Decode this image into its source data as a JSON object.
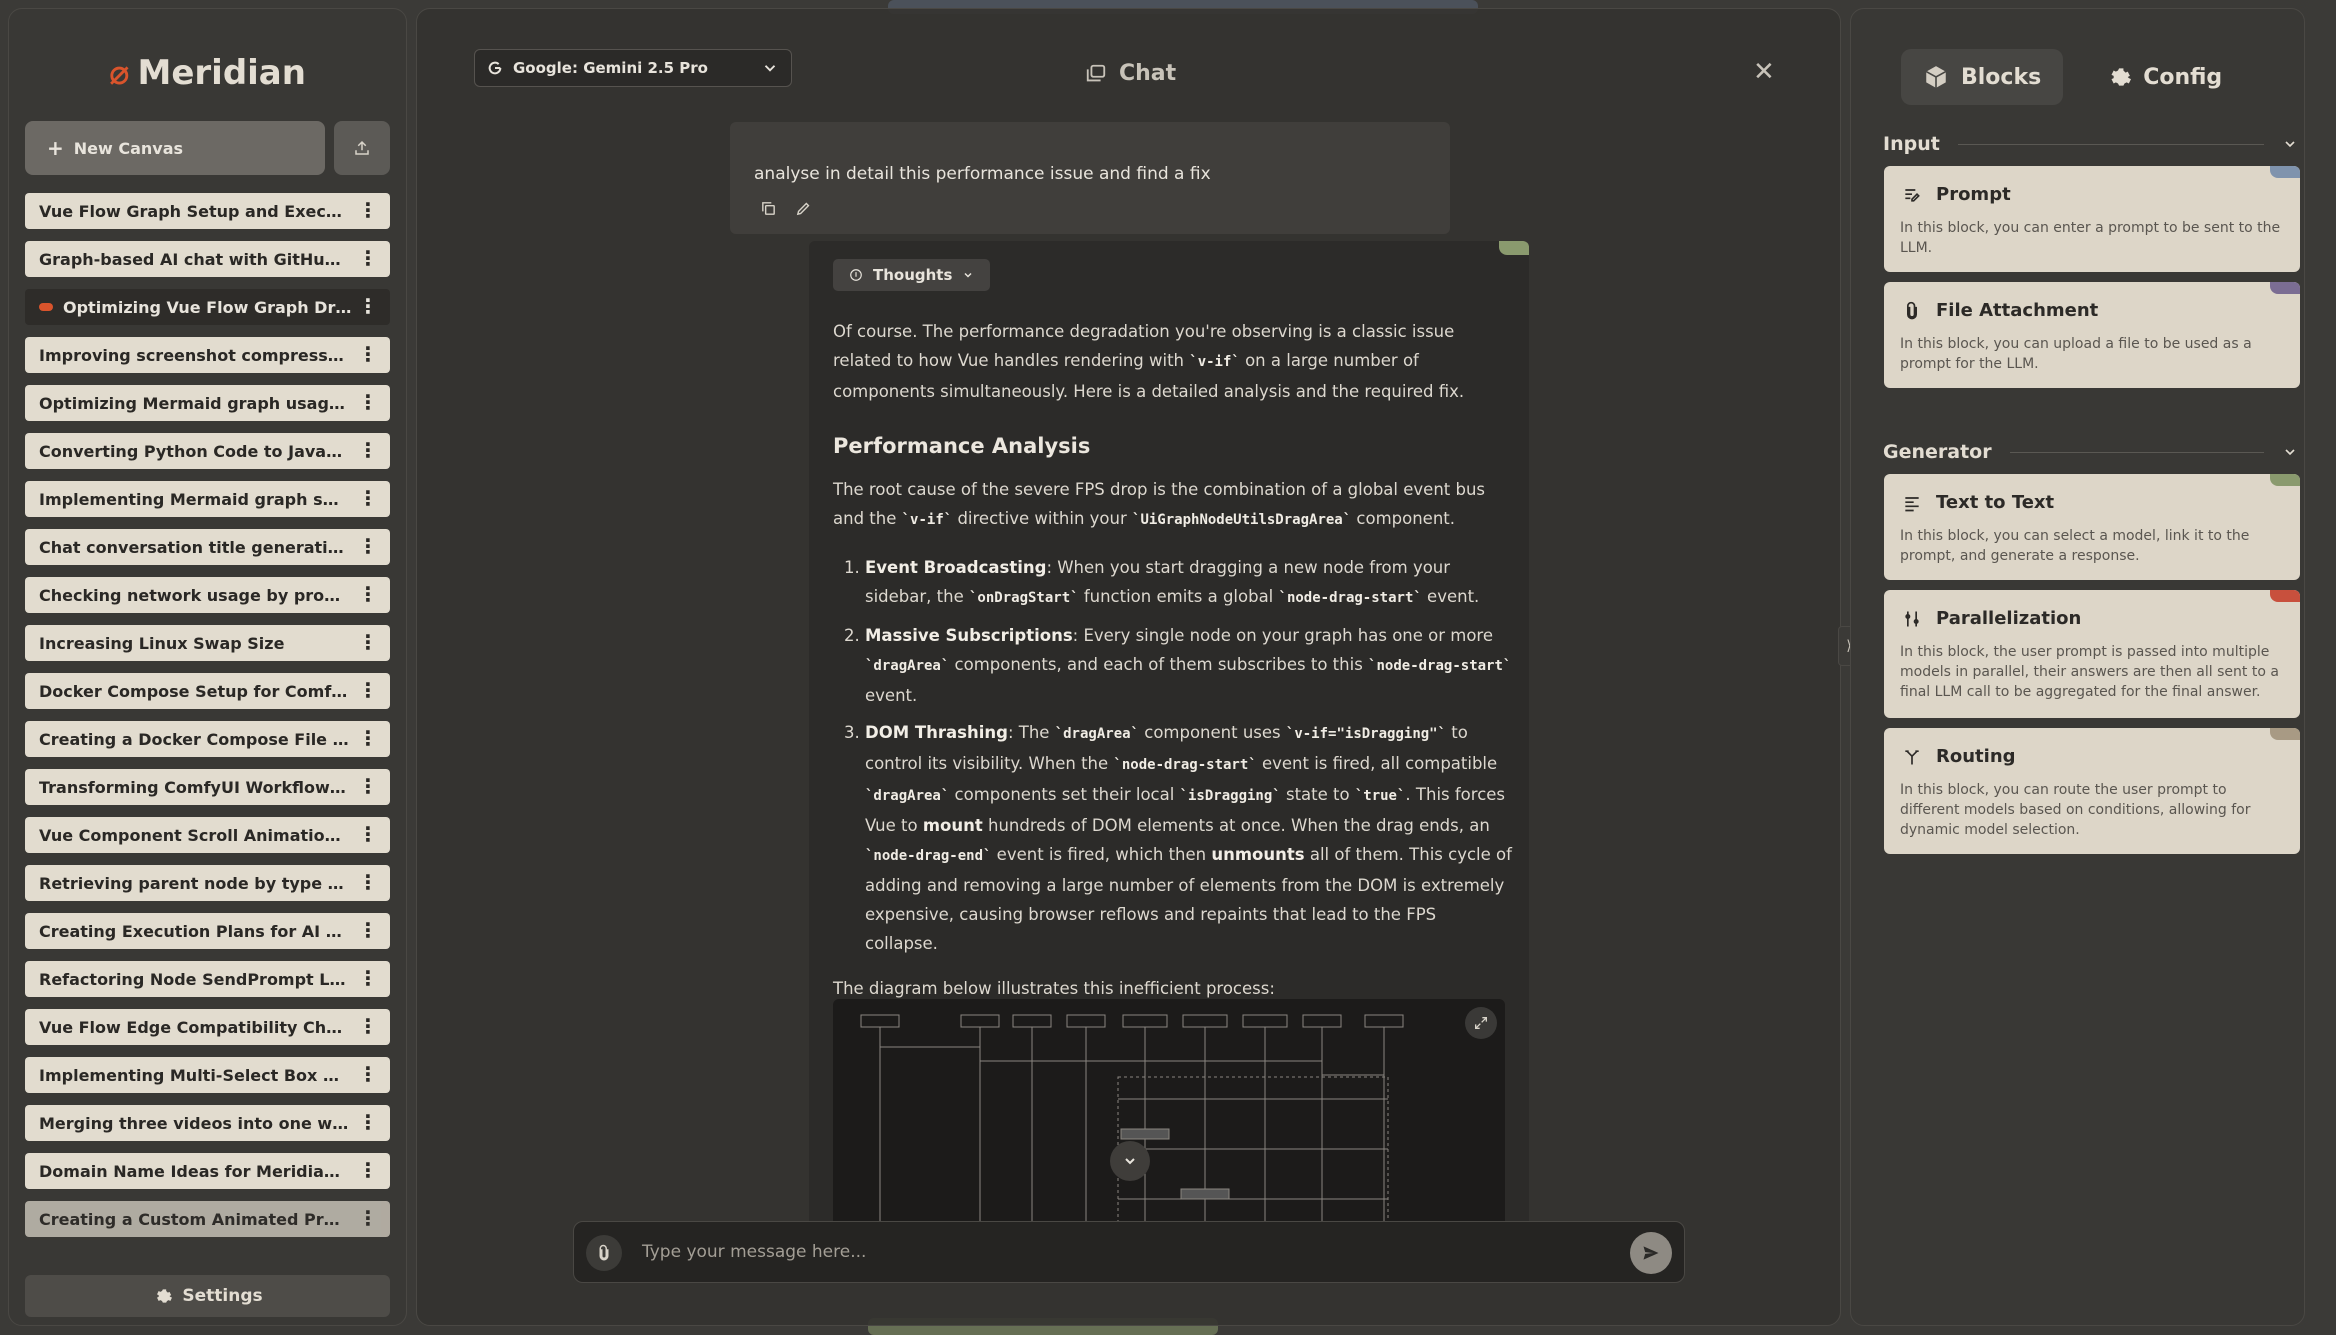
{
  "app": {
    "logo_text": "Meridian",
    "new_canvas_label": "New Canvas",
    "settings_label": "Settings",
    "accent_color": "#d9542c"
  },
  "sidebar": {
    "conversations": [
      {
        "title": "Vue Flow Graph Setup and Execution ..."
      },
      {
        "title": "Graph-based AI chat with GitHub RAG..."
      },
      {
        "title": "Optimizing Vue Flow Graph Drag a..."
      },
      {
        "title": "Improving screenshot compression q..."
      },
      {
        "title": "Optimizing Mermaid graph usage for ..."
      },
      {
        "title": "Converting Python Code to JavaScript..."
      },
      {
        "title": "Implementing Mermaid graph suppo..."
      },
      {
        "title": "Chat conversation title generation as..."
      },
      {
        "title": "Checking network usage by process i..."
      },
      {
        "title": "Increasing Linux Swap Size"
      },
      {
        "title": "Docker Compose Setup for ComfyUI ..."
      },
      {
        "title": "Creating a Docker Compose File for C..."
      },
      {
        "title": "Transforming ComfyUI Workflow into..."
      },
      {
        "title": "Vue Component Scroll Animation for ..."
      },
      {
        "title": "Retrieving parent node by type or list ..."
      },
      {
        "title": "Creating Execution Plans for AI Chat ..."
      },
      {
        "title": "Refactoring Node SendPrompt Logic f..."
      },
      {
        "title": "Vue Flow Edge Compatibility Check Is..."
      },
      {
        "title": "Implementing Multi-Select Box Featu..."
      },
      {
        "title": "Merging three videos into one with ff..."
      },
      {
        "title": "Domain Name Ideas for Meridian AI A..."
      },
      {
        "title": "Creating a Custom Animated Progres..."
      }
    ],
    "active_index": 2
  },
  "chat": {
    "title": "Chat",
    "model": "Google: Gemini 2.5 Pro",
    "user_message": "analyse in detail this performance issue and find a fix",
    "thoughts_label": "Thoughts",
    "reply": {
      "intro_a": "Of course. The performance degradation you're observing is a classic issue related to how Vue handles rendering with ",
      "intro_code": "`v-if`",
      "intro_b": " on a large number of components simultaneously. Here is a detailed analysis and the required fix.",
      "heading": "Performance Analysis",
      "root_a": "The root cause of the severe FPS drop is the combination of a global event bus and the ",
      "root_code1": "`v-if`",
      "root_b": " directive within your ",
      "root_code2": "`UiGraphNodeUtilsDragArea`",
      "root_c": " component.",
      "items": [
        {
          "strong": "Event Broadcasting",
          "a": ": When you start dragging a new node from your sidebar, the ",
          "c1": "`onDragStart`",
          "b": " function emits a global ",
          "c2": "`node-drag-start`",
          "c": " event."
        },
        {
          "strong": "Massive Subscriptions",
          "a": ": Every single node on your graph has one or more ",
          "c1": "`dragArea`",
          "b": " components, and each of them subscribes to this ",
          "c2": "`node-drag-start`",
          "c": " event."
        },
        {
          "strong": "DOM Thrashing",
          "a": ": The ",
          "c1": "`dragArea`",
          "b": " component uses ",
          "c2": "`v-if=\"isDragging\"`",
          "c": " to control its visibility. When the ",
          "c3": "`node-drag-start`",
          "d": " event is fired, all compatible ",
          "c4": "`dragArea`",
          "e": " components set their local ",
          "c5": "`isDragging`",
          "f": " state to ",
          "c6": "`true`",
          "g": ". This forces Vue to ",
          "s2": "mount",
          "h": " hundreds of DOM elements at once. When the drag ends, an ",
          "c7": "`node-drag-end`",
          "i": " event is fired, which then ",
          "s3": "unmounts",
          "j": " all of them. This cycle of adding and removing a large number of elements from the DOM is extremely expensive, causing browser reflows and repaints that lead to the FPS collapse."
        }
      ],
      "diagram_intro": "The diagram below illustrates this inefficient process:"
    },
    "composer_placeholder": "Type your message here..."
  },
  "panel": {
    "tabs": [
      {
        "label": "Blocks",
        "active": true
      },
      {
        "label": "Config",
        "active": false
      }
    ],
    "sections": [
      {
        "title": "Input",
        "blocks": [
          {
            "name": "Prompt",
            "desc": "In this block, you can enter a prompt to be sent to the LLM.",
            "color": "#7f93ad",
            "icon": "prompt-icon"
          },
          {
            "name": "File Attachment",
            "desc": "In this block, you can upload a file to be used as a prompt for the LLM.",
            "color": "#7b6d93",
            "icon": "paperclip-icon"
          }
        ]
      },
      {
        "title": "Generator",
        "blocks": [
          {
            "name": "Text to Text",
            "desc": "In this block, you can select a model, link it to the prompt, and generate a response.",
            "color": "#8a9a6e",
            "icon": "text-lines-icon"
          },
          {
            "name": "Parallelization",
            "desc": "In this block, the user prompt is passed into multiple models in parallel, their answers are then all sent to a final LLM call to be aggregated for the final answer.",
            "color": "#c8503d",
            "icon": "parallel-icon"
          },
          {
            "name": "Routing",
            "desc": "In this block, you can route the user prompt to different models based on conditions, allowing for dynamic model selection.",
            "color": "#a89a84",
            "icon": "routing-icon"
          }
        ]
      }
    ]
  }
}
